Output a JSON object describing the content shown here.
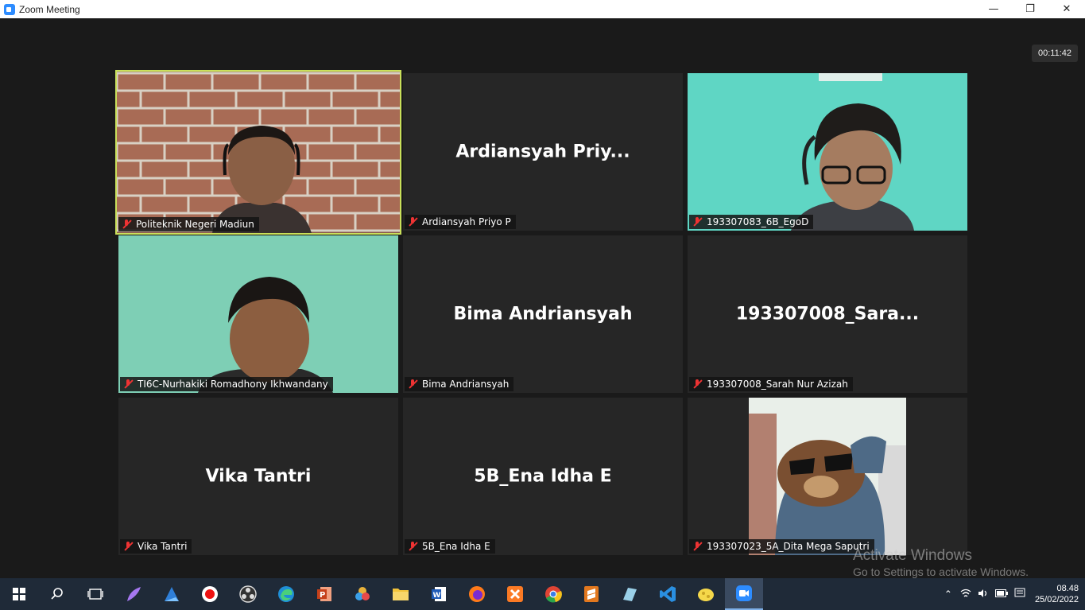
{
  "window": {
    "title": "Zoom Meeting",
    "minimize": "—",
    "restore": "❐",
    "close": "✕"
  },
  "meeting": {
    "timer": "00:11:42"
  },
  "tiles": [
    {
      "name": "Politeknik Negeri Madiun",
      "video": true,
      "active": true
    },
    {
      "name": "Ardiansyah Priyo P",
      "display": "Ardiansyah  Priy...",
      "video": false
    },
    {
      "name": "193307083_6B_EgoD",
      "video": true
    },
    {
      "name": "TI6C-Nurhakiki Romadhony Ikhwandany",
      "video": true
    },
    {
      "name": "Bima Andriansyah",
      "display": "Bima Andriansyah",
      "video": false
    },
    {
      "name": "193307008_Sarah Nur Azizah",
      "display": "193307008_Sara...",
      "video": false
    },
    {
      "name": "Vika Tantri",
      "display": "Vika Tantri",
      "video": false
    },
    {
      "name": "5B_Ena Idha E",
      "display": "5B_Ena Idha E",
      "video": false
    },
    {
      "name": "193307023_5A_Dita Mega Saputri",
      "video": true
    }
  ],
  "watermark": {
    "line1": "Activate Windows",
    "line2": "Go to Settings to activate Windows."
  },
  "taskbar": {
    "apps": [
      "windows-start-icon",
      "search-icon",
      "task-view-icon",
      "feather-app-icon",
      "sail-app-icon",
      "record-app-icon",
      "obs-icon",
      "edge-icon",
      "powerpoint-icon",
      "davinci-icon",
      "file-explorer-icon",
      "word-icon",
      "firefox-icon",
      "xampp-icon",
      "chrome-icon",
      "sublime-icon",
      "notes-app-icon",
      "vscode-icon",
      "cheese-app-icon",
      "zoom-icon"
    ],
    "time": "08.48",
    "date": "25/02/2022"
  }
}
